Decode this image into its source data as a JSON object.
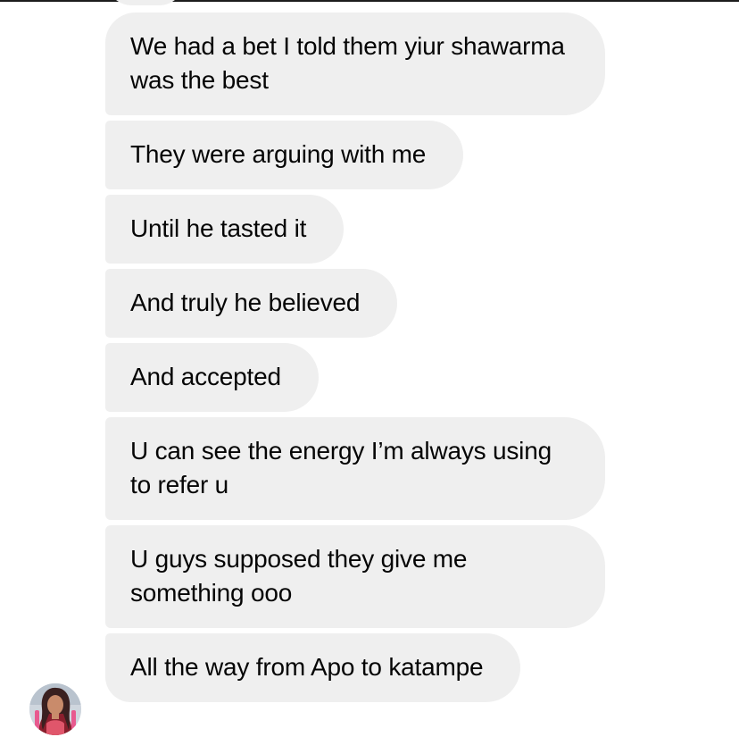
{
  "messages": [
    {
      "text": "We had a bet I told them yiur shawarma was the best"
    },
    {
      "text": "They were arguing with me"
    },
    {
      "text": "Until he tasted it"
    },
    {
      "text": "And truly he believed"
    },
    {
      "text": "And accepted"
    },
    {
      "text": "U can see the energy I’m always using to refer u"
    },
    {
      "text": "U guys supposed they give me something ooo"
    },
    {
      "text": "All the way from Apo to katampe"
    }
  ],
  "colors": {
    "bubble_bg": "#efefef",
    "text": "#050505",
    "background": "#ffffff"
  }
}
